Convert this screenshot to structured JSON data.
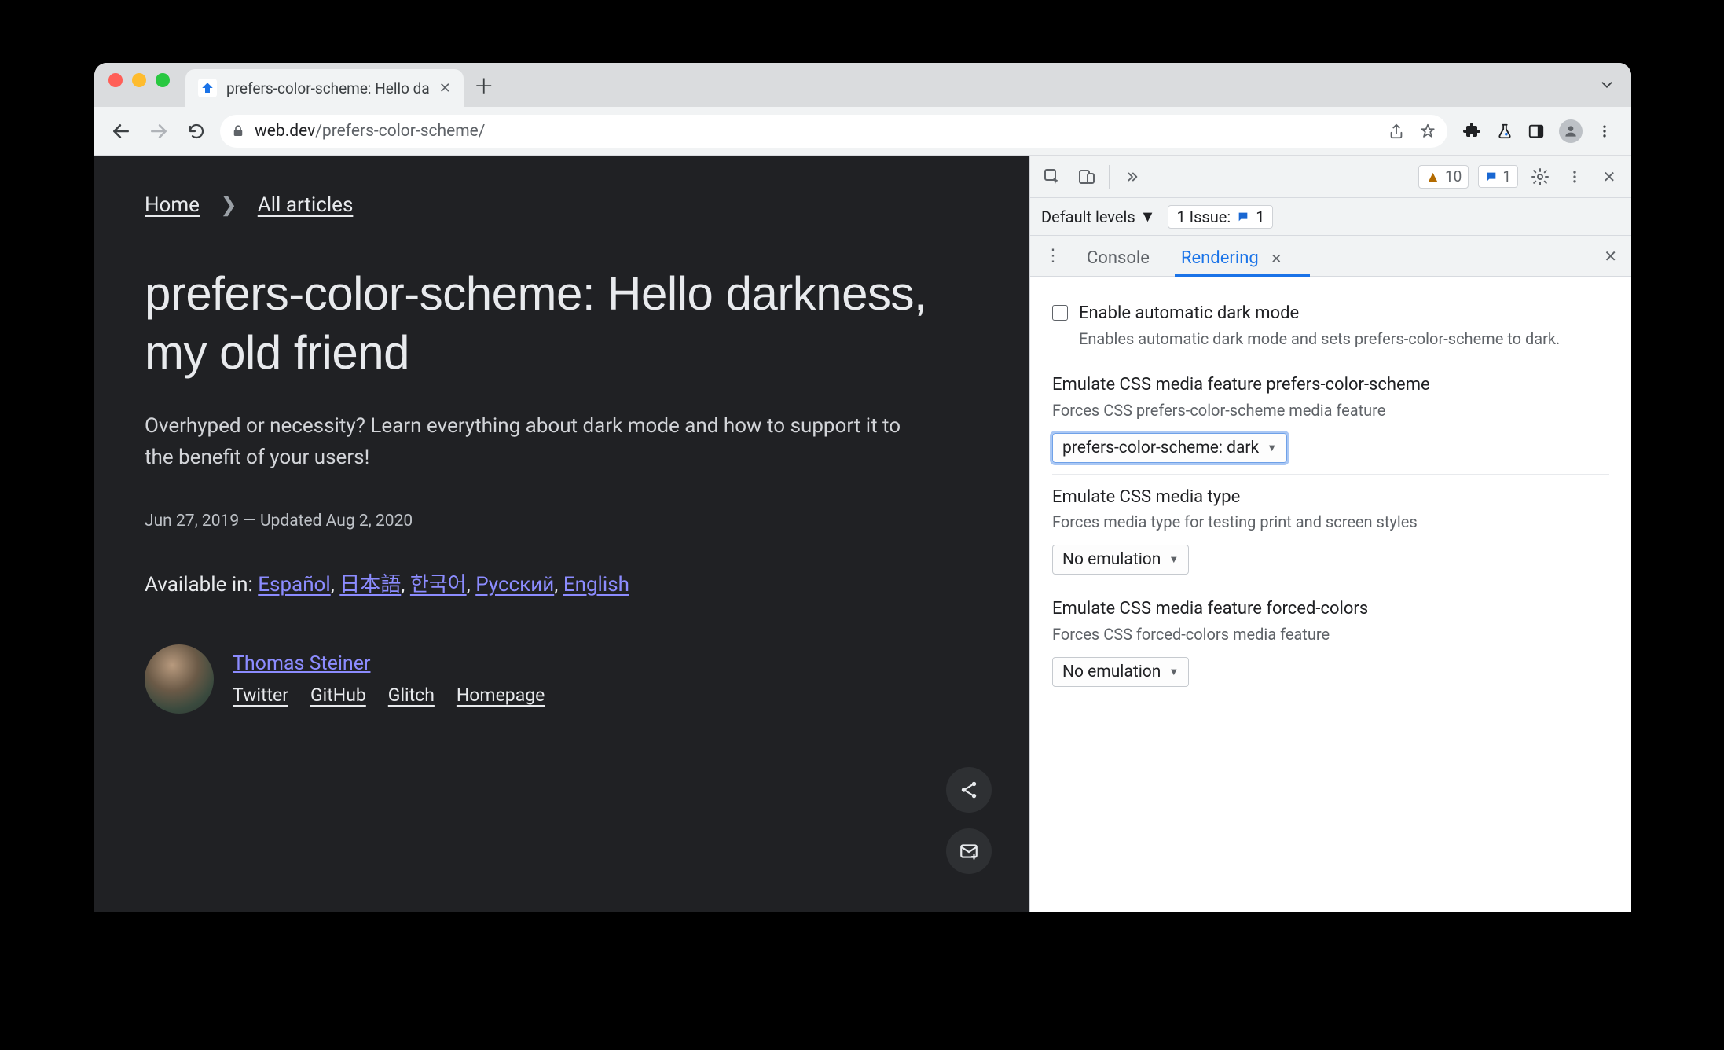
{
  "browser": {
    "tab_title": "prefers-color-scheme: Hello da",
    "url_host": "web.dev",
    "url_path": "/prefers-color-scheme/"
  },
  "page": {
    "breadcrumbs": {
      "home": "Home",
      "all": "All articles"
    },
    "title": "prefers-color-scheme: Hello darkness, my old friend",
    "subtitle": "Overhyped or necessity? Learn everything about dark mode and how to support it to the benefit of your users!",
    "date_line": "Jun 27, 2019 — Updated Aug 2, 2020",
    "available_label": "Available in: ",
    "langs": {
      "es": "Español",
      "ja": "日本語",
      "ko": "한국어",
      "ru": "Русский",
      "en": "English"
    },
    "author": {
      "name": "Thomas Steiner",
      "links": {
        "twitter": "Twitter",
        "github": "GitHub",
        "glitch": "Glitch",
        "homepage": "Homepage"
      }
    }
  },
  "devtools": {
    "warnings_count": "10",
    "info_count": "1",
    "levels_label": "Default levels",
    "issue_label": "1 Issue:",
    "issue_count": "1",
    "drawer": {
      "console": "Console",
      "rendering": "Rendering"
    },
    "rendering": {
      "auto_dark": {
        "title": "Enable automatic dark mode",
        "desc": "Enables automatic dark mode and sets prefers-color-scheme to dark."
      },
      "pcs": {
        "title": "Emulate CSS media feature prefers-color-scheme",
        "desc": "Forces CSS prefers-color-scheme media feature",
        "value": "prefers-color-scheme: dark"
      },
      "media_type": {
        "title": "Emulate CSS media type",
        "desc": "Forces media type for testing print and screen styles",
        "value": "No emulation"
      },
      "forced_colors": {
        "title": "Emulate CSS media feature forced-colors",
        "desc": "Forces CSS forced-colors media feature",
        "value": "No emulation"
      }
    }
  }
}
